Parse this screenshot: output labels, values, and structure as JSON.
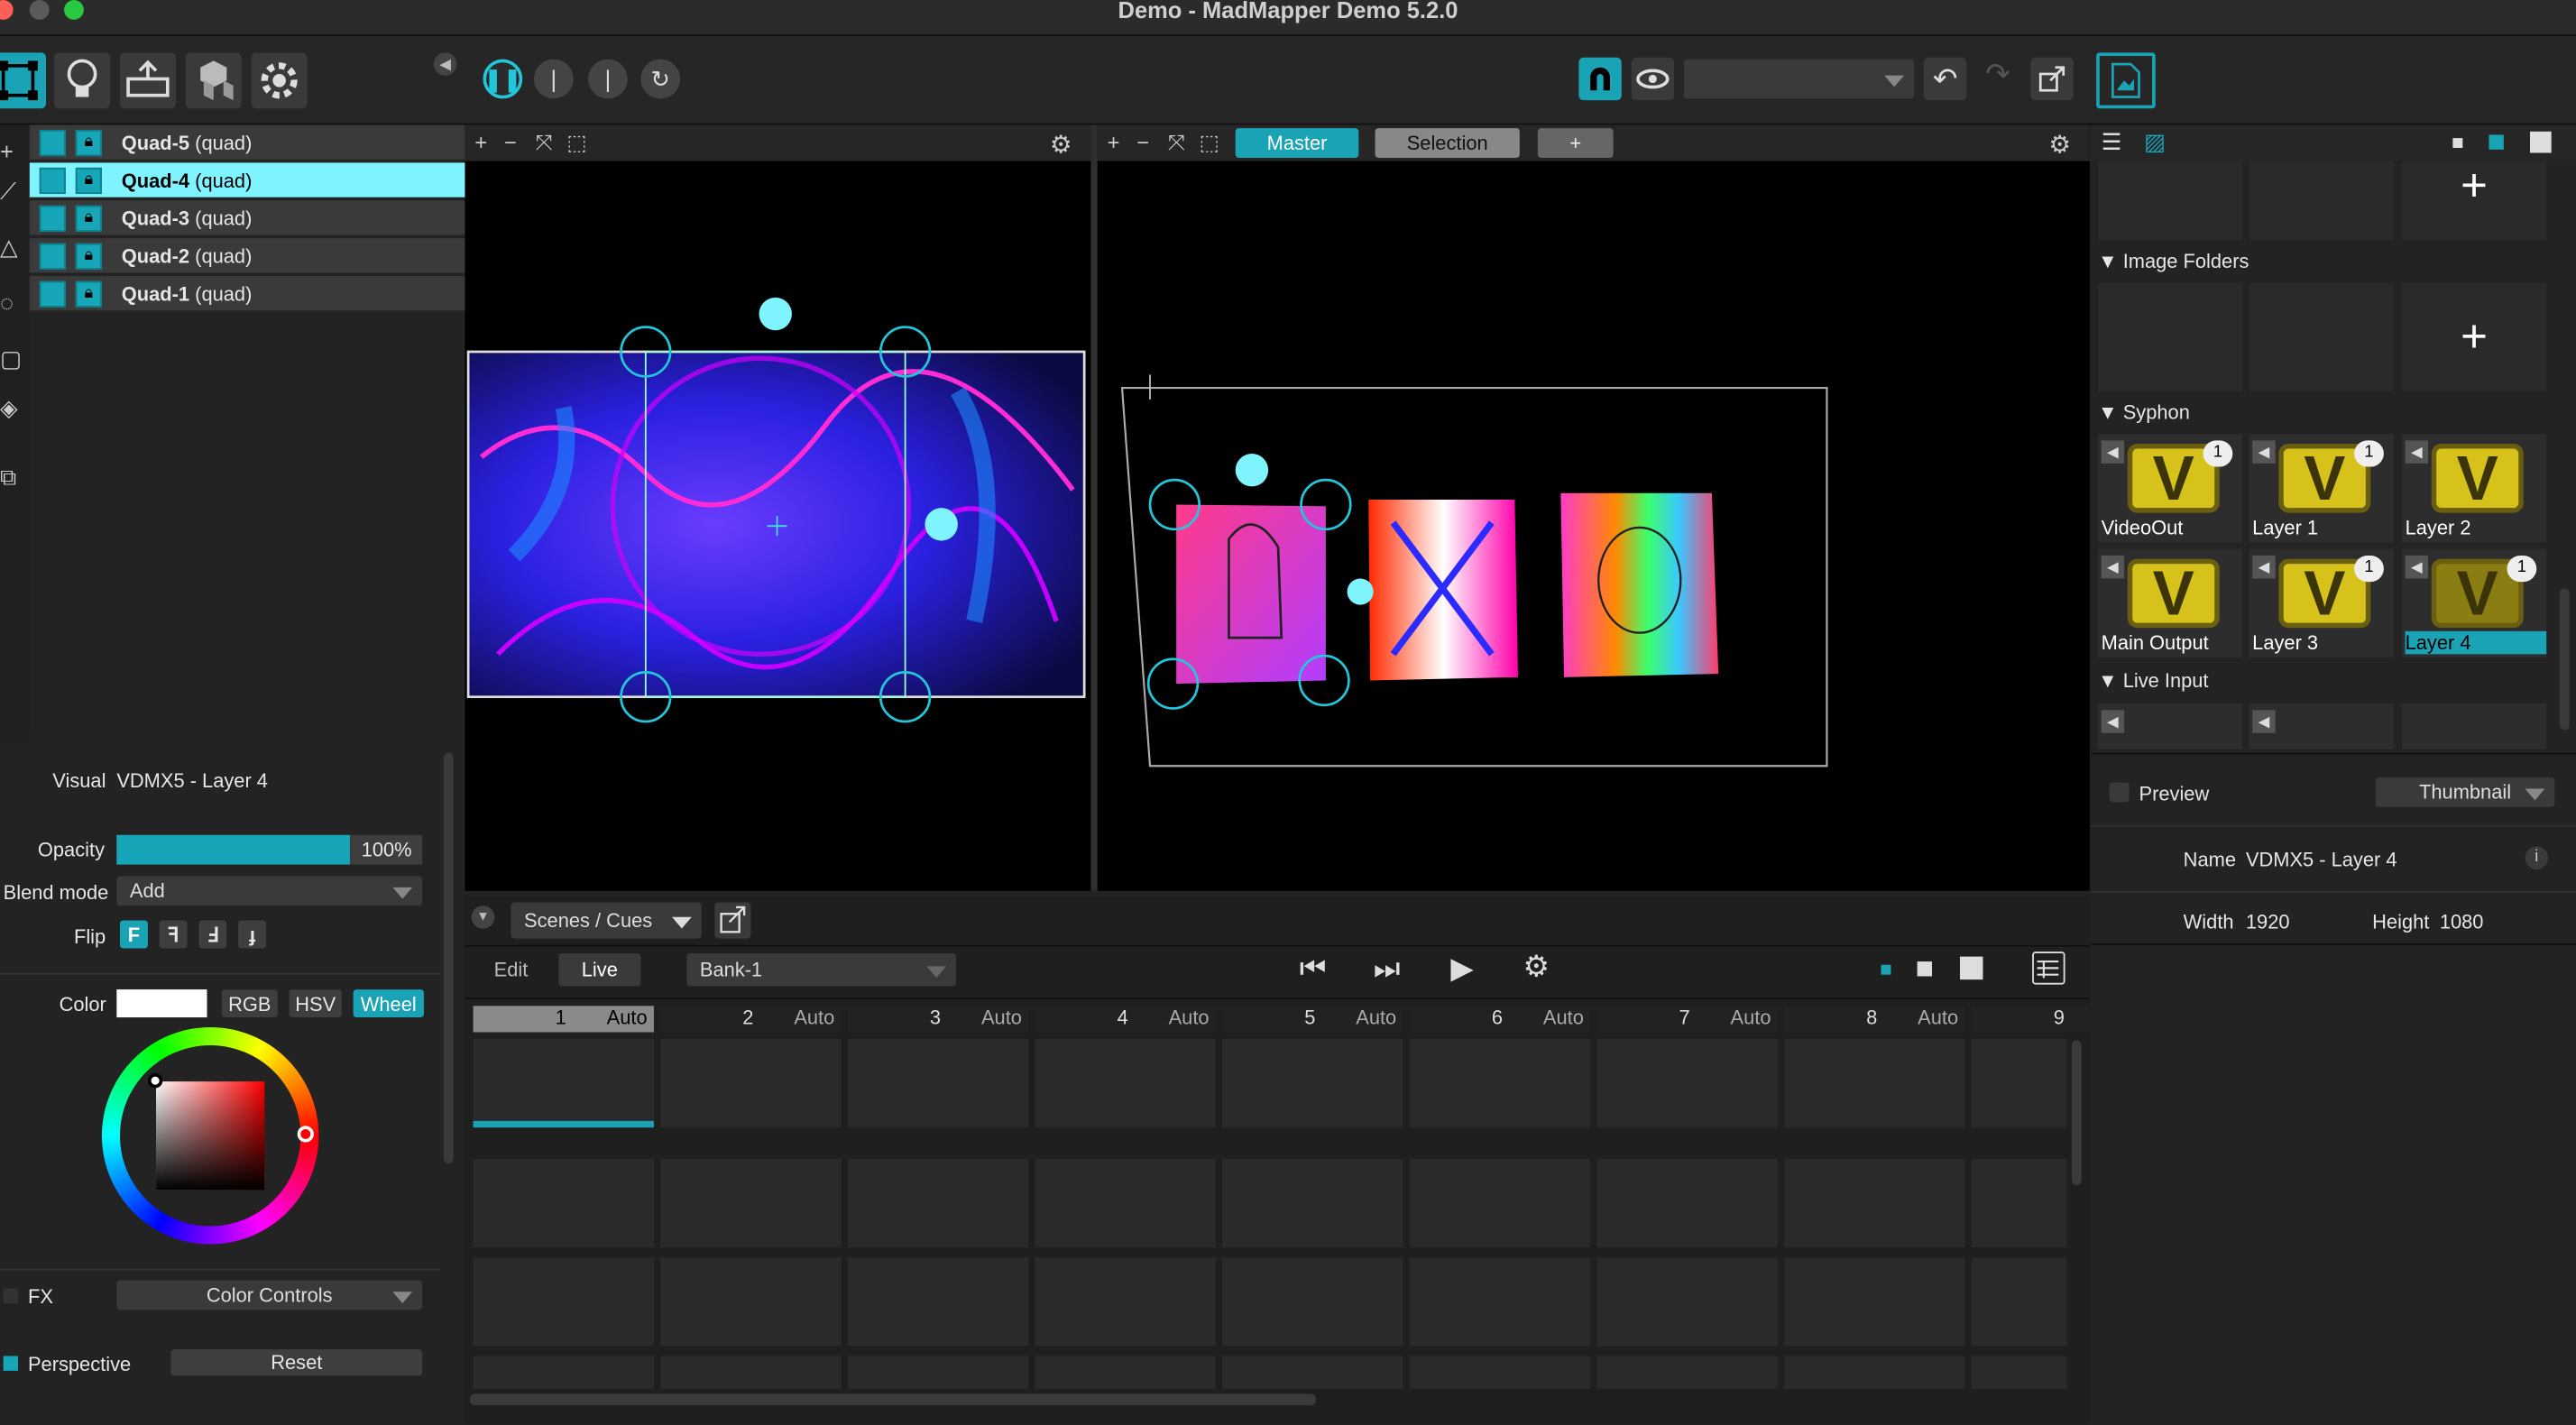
{
  "window": {
    "title": "Demo - MadMapper Demo 5.2.0"
  },
  "toolbar": {
    "modes": [
      "surface-mode",
      "light-mode",
      "output-mode",
      "3d-mode",
      "settings-mode"
    ],
    "transport": [
      "pause",
      "step",
      "step",
      "loop"
    ],
    "output_select": ""
  },
  "layers": [
    {
      "name": "Quad-5",
      "type": "(quad)",
      "selected": false
    },
    {
      "name": "Quad-4",
      "type": "(quad)",
      "selected": true
    },
    {
      "name": "Quad-3",
      "type": "(quad)",
      "selected": false
    },
    {
      "name": "Quad-2",
      "type": "(quad)",
      "selected": false
    },
    {
      "name": "Quad-1",
      "type": "(quad)",
      "selected": false
    }
  ],
  "inspector": {
    "visual_label": "Visual",
    "visual_value": "VDMX5 - Layer 4",
    "opacity_label": "Opacity",
    "opacity_value": "100%",
    "blend_label": "Blend mode",
    "blend_value": "Add",
    "flip_label": "Flip",
    "color_label": "Color",
    "color_modes": [
      "RGB",
      "HSV",
      "Wheel"
    ],
    "fx_label": "FX",
    "fx_value": "Color Controls",
    "perspective_label": "Perspective",
    "reset_label": "Reset"
  },
  "output_view": {
    "tabs": [
      "Master",
      "Selection",
      "+"
    ]
  },
  "media": {
    "image_folders": "Image Folders",
    "syphon": "Syphon",
    "live_input": "Live Input",
    "syphon_items": [
      {
        "label": "VideoOut",
        "badge": "1"
      },
      {
        "label": "Layer 1",
        "badge": "1"
      },
      {
        "label": "Layer 2",
        "badge": ""
      },
      {
        "label": "Main Output",
        "badge": ""
      },
      {
        "label": "Layer 3",
        "badge": "1"
      },
      {
        "label": "Layer 4",
        "badge": "1"
      }
    ],
    "preview_label": "Preview",
    "preview_mode": "Thumbnail",
    "name_label": "Name",
    "name_value": "VDMX5 - Layer 4",
    "width_label": "Width",
    "width_value": "1920",
    "height_label": "Height",
    "height_value": "1080"
  },
  "scenes": {
    "panel_select": "Scenes / Cues",
    "edit_label": "Edit",
    "live_label": "Live",
    "bank": "Bank-1",
    "cues": [
      {
        "num": "1",
        "mode": "Auto"
      },
      {
        "num": "2",
        "mode": "Auto"
      },
      {
        "num": "3",
        "mode": "Auto"
      },
      {
        "num": "4",
        "mode": "Auto"
      },
      {
        "num": "5",
        "mode": "Auto"
      },
      {
        "num": "6",
        "mode": "Auto"
      },
      {
        "num": "7",
        "mode": "Auto"
      },
      {
        "num": "8",
        "mode": "Auto"
      },
      {
        "num": "9",
        "mode": ""
      }
    ]
  },
  "colors": {
    "accent": "#1aa3b5",
    "selection": "#7ff4ff",
    "handles": "#22c6d8"
  }
}
